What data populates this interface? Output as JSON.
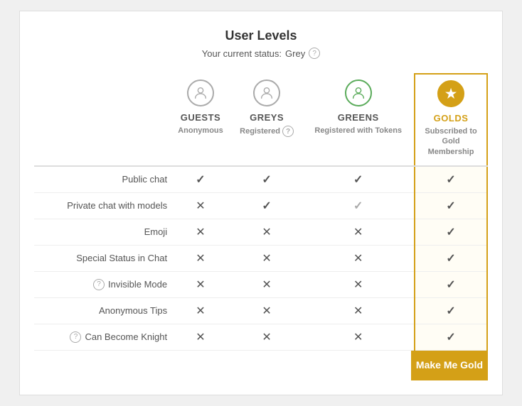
{
  "title": "User Levels",
  "status": {
    "label": "Your current status:",
    "value": "Grey"
  },
  "columns": [
    {
      "id": "feature",
      "label": ""
    },
    {
      "id": "guests",
      "name": "GUESTS",
      "sub": "Anonymous",
      "icon": "person",
      "iconStyle": "grey"
    },
    {
      "id": "greys",
      "name": "GREYS",
      "sub": "Registered",
      "icon": "person",
      "iconStyle": "grey",
      "hasHelp": true
    },
    {
      "id": "greens",
      "name": "GREENS",
      "sub": "Registered with Tokens",
      "icon": "person",
      "iconStyle": "green"
    },
    {
      "id": "golds",
      "name": "GOLDS",
      "sub": "Subscribed to Gold Membership",
      "icon": "star",
      "iconStyle": "gold"
    }
  ],
  "rows": [
    {
      "feature": "Public chat",
      "hasHelp": false,
      "guests": "check",
      "greys": "check",
      "greens": "check",
      "golds": "check"
    },
    {
      "feature": "Private chat with models",
      "hasHelp": false,
      "guests": "cross",
      "greys": "check",
      "greens": "check",
      "golds": "check"
    },
    {
      "feature": "Emoji",
      "hasHelp": false,
      "guests": "cross",
      "greys": "cross",
      "greens": "cross",
      "golds": "check"
    },
    {
      "feature": "Special Status in Chat",
      "hasHelp": false,
      "guests": "cross",
      "greys": "cross",
      "greens": "cross",
      "golds": "check"
    },
    {
      "feature": "Invisible Mode",
      "hasHelp": true,
      "guests": "cross",
      "greys": "cross",
      "greens": "cross",
      "golds": "check"
    },
    {
      "feature": "Anonymous Tips",
      "hasHelp": false,
      "guests": "cross",
      "greys": "cross",
      "greens": "cross",
      "golds": "check"
    },
    {
      "feature": "Can Become Knight",
      "hasHelp": true,
      "guests": "cross",
      "greys": "cross",
      "greens": "cross",
      "golds": "check"
    }
  ],
  "cta_button": "Make Me Gold",
  "icons": {
    "check": "✓",
    "cross": "✕",
    "star": "★",
    "question": "?"
  }
}
